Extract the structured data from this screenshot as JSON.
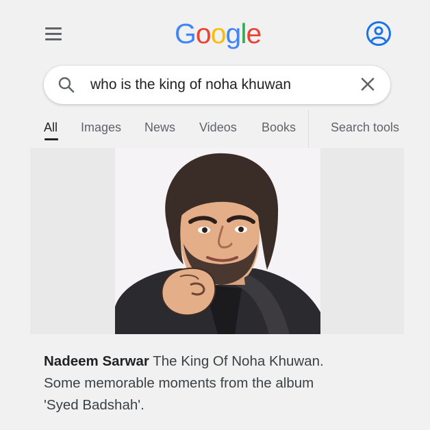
{
  "header": {
    "logo": {
      "letters": [
        "G",
        "o",
        "o",
        "g",
        "l",
        "e"
      ],
      "colors": [
        "#4285f4",
        "#ea4335",
        "#fbbc05",
        "#4285f4",
        "#34a853",
        "#ea4335"
      ]
    },
    "menu_icon": "hamburger-menu-icon",
    "account_icon": "account-circle-icon"
  },
  "search": {
    "query": "who is the king of noha khuwan",
    "search_icon": "search-icon",
    "clear_icon": "close-icon"
  },
  "tabs": [
    {
      "label": "All",
      "active": true
    },
    {
      "label": "Images",
      "active": false
    },
    {
      "label": "News",
      "active": false
    },
    {
      "label": "Videos",
      "active": false
    },
    {
      "label": "Books",
      "active": false
    },
    {
      "label": "Search tools",
      "active": false
    }
  ],
  "result": {
    "image_description": "cartoon-portrait",
    "caption": {
      "name": "Nadeem Sarwar",
      "line1": " The King Of Noha Khuwan.",
      "line2": "Some memorable moments from the album",
      "line3": "'Syed Badshah'."
    }
  },
  "colors": {
    "background": "#f1f1f1",
    "text_primary": "#202124",
    "text_secondary": "#5f6368"
  }
}
